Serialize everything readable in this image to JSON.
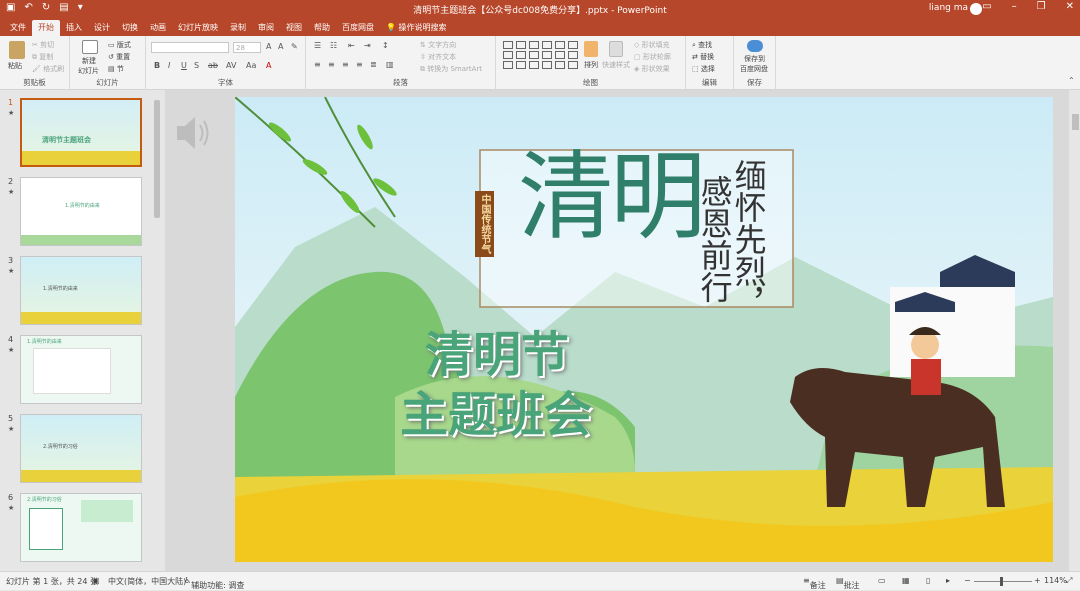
{
  "window": {
    "title": "清明节主题班会【公众号dc008免费分享】.pptx  -  PowerPoint",
    "user": "liang ma"
  },
  "tabs": [
    "文件",
    "开始",
    "插入",
    "设计",
    "切换",
    "动画",
    "幻灯片放映",
    "录制",
    "审阅",
    "视图",
    "帮助",
    "百度网盘",
    "操作说明搜索"
  ],
  "active_tab": "开始",
  "ribbon": {
    "clipboard": {
      "paste": "粘贴",
      "cut": "剪切",
      "copy": "复制",
      "format_painter": "格式刷",
      "label": "剪贴板"
    },
    "slides": {
      "new_slide": "新建",
      "new_slide2": "幻灯片",
      "layout": "版式",
      "reset": "重置",
      "section": "节",
      "label": "幻灯片"
    },
    "font": {
      "size": "28",
      "label": "字体"
    },
    "paragraph": {
      "text_direction": "文字方向",
      "align_text": "对齐文本",
      "smartart": "转换为 SmartArt",
      "label": "段落"
    },
    "drawing": {
      "arrange": "排列",
      "quick_styles": "快速样式",
      "shape_fill": "形状填充",
      "shape_outline": "形状轮廓",
      "shape_effects": "形状效果",
      "label": "绘图"
    },
    "editing": {
      "find": "查找",
      "replace": "替换",
      "select": "选择",
      "label": "编辑"
    },
    "save": {
      "save_to": "保存到",
      "baidu": "百度网盘",
      "label": "保存"
    }
  },
  "slides_panel": [
    {
      "num": "1",
      "caption": "清明节主题班会",
      "selected": true
    },
    {
      "num": "2",
      "caption": "1.清明节的由来",
      "selected": false
    },
    {
      "num": "3",
      "caption": "1.清明节的由来",
      "selected": false
    },
    {
      "num": "4",
      "caption": "1.清明节的由来",
      "selected": false
    },
    {
      "num": "5",
      "caption": "2.清明节的习俗",
      "selected": false
    },
    {
      "num": "6",
      "caption": "2.清明节的习俗",
      "selected": false
    }
  ],
  "thumb_star": "★",
  "slide": {
    "badge": "中国传统节气",
    "big_logo": "清明",
    "poem_col1": "缅怀先烈，",
    "poem_col2": "感恩前行",
    "title_line1": "清明节",
    "title_line2": "主题班会"
  },
  "status": {
    "slide_info": "幻灯片 第 1 张，共 24 张",
    "language": "中文(简体，中国大陆)",
    "accessibility": "辅助功能: 调查",
    "notes": "备注",
    "comments": "批注",
    "zoom": "114%"
  },
  "colors": {
    "accent": "#b7472a",
    "title_green": "#4aa47a",
    "logo_green": "#2f7f6a"
  }
}
